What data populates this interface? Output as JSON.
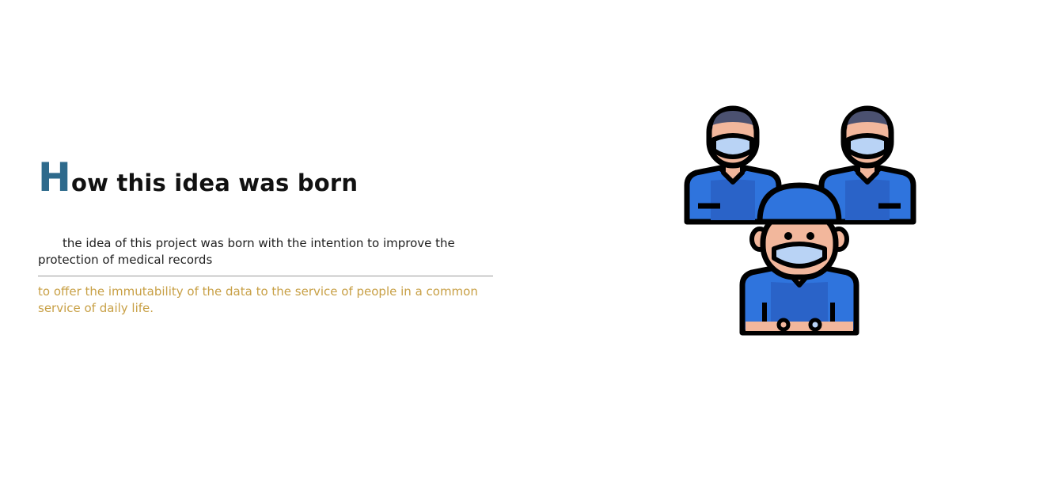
{
  "section": {
    "title_initial": "H",
    "title_rest": "ow this idea was born",
    "paragraph": "the idea of this project was born with the intention to improve the protection of medical records",
    "note": "to offer the immutability of the data to the service of people in a common service of daily life."
  },
  "illustration": {
    "icon": "medical-staff-icon",
    "colors": {
      "outline": "#000000",
      "uniform": "#2f74dd",
      "uniform_shade": "#2a63c8",
      "skin": "#f2b79c",
      "hair": "#4b5170",
      "mask": "#b9d3f5"
    }
  },
  "theme": {
    "accent": "#2e6a8c",
    "highlight": "#c8a046",
    "text": "#111111",
    "divider": "#9a9a9a"
  }
}
